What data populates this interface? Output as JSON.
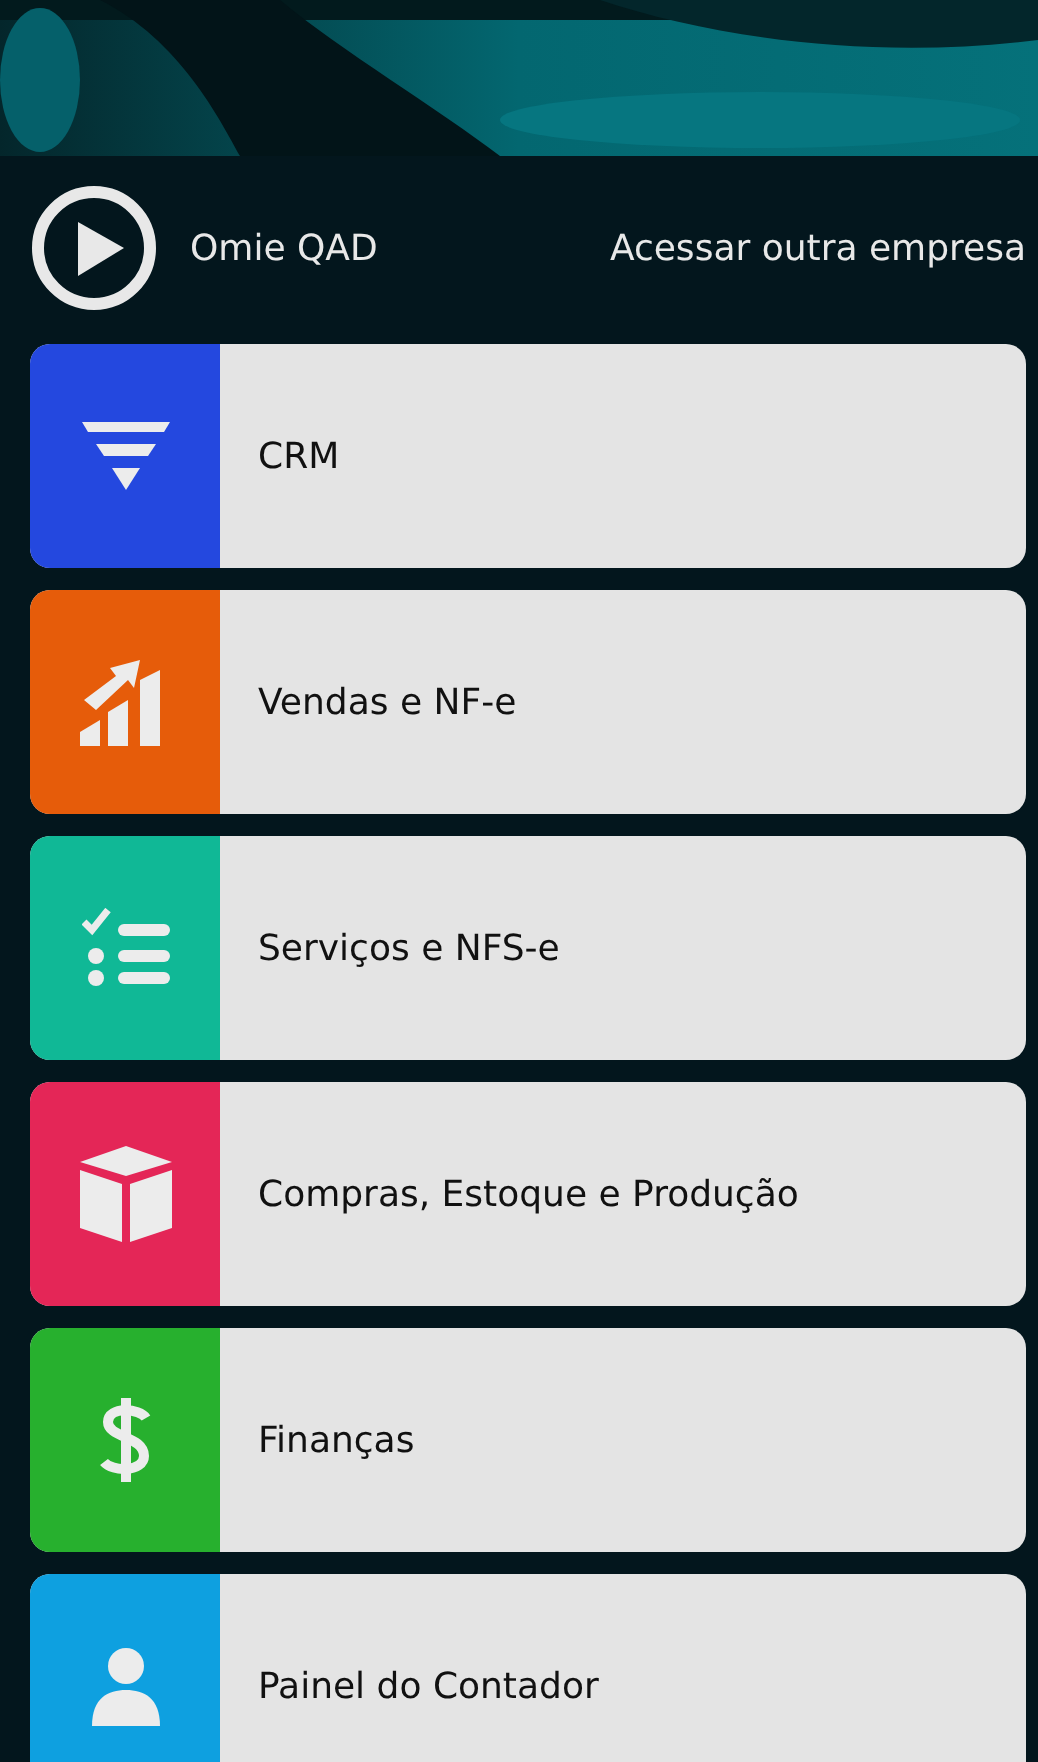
{
  "company": {
    "name": "Omie QAD",
    "switch_link": "Acessar outra empresa"
  },
  "modules": [
    {
      "label": "CRM",
      "kind": "funnel",
      "color": "#2448df"
    },
    {
      "label": "Vendas e NF-e",
      "kind": "chart",
      "color": "#e65c0a"
    },
    {
      "label": "Serviços e NFS-e",
      "kind": "checklist",
      "color": "#10b896"
    },
    {
      "label": "Compras, Estoque e Produção",
      "kind": "box",
      "color": "#e42657"
    },
    {
      "label": "Finanças",
      "kind": "dollar",
      "color": "#27b02e"
    },
    {
      "label": "Painel do Contador",
      "kind": "person",
      "color": "#0ea0e0"
    }
  ]
}
